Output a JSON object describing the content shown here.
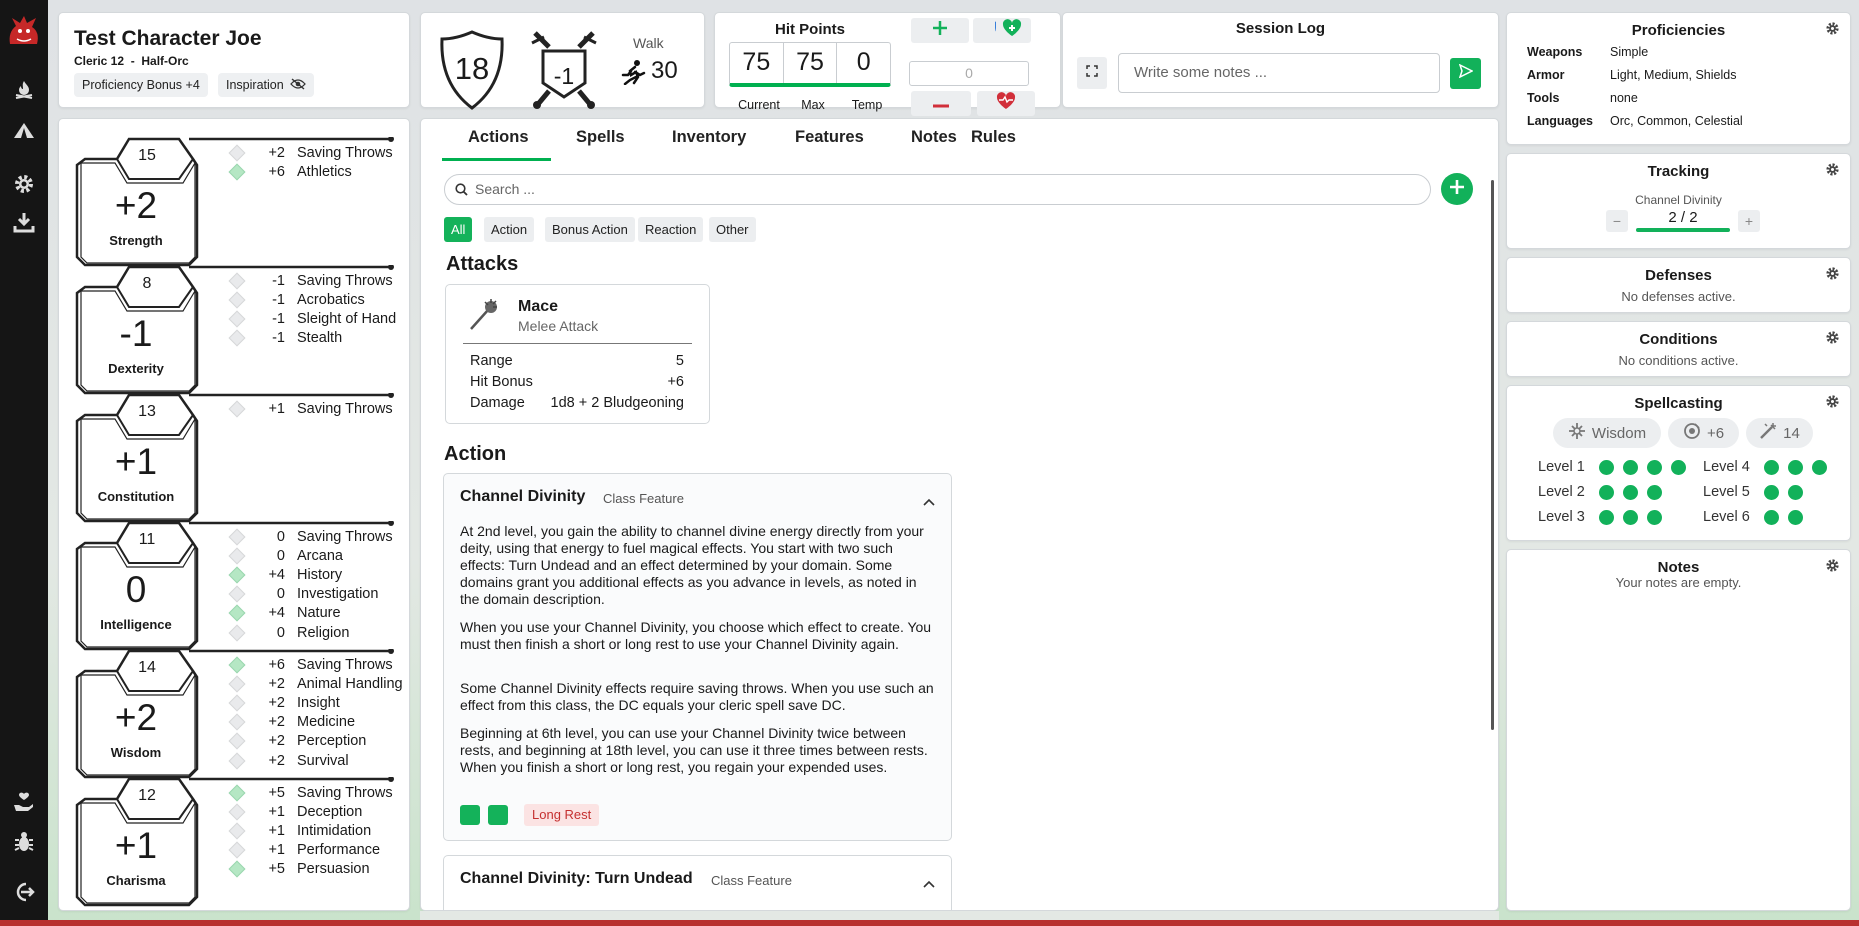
{
  "colors": {
    "accent": "#12b15a",
    "danger": "#c53030",
    "sidebar": "#151515"
  },
  "sidebar": {
    "icons": [
      "dragon-logo-icon",
      "campfire-icon",
      "tent-icon",
      "gear-icon",
      "download-icon",
      "hand-heart-icon",
      "bug-icon",
      "logout-icon"
    ]
  },
  "character": {
    "name": "Test Character Joe",
    "class_line": "Cleric 12  -  Half-Orc",
    "proficiency_bonus": "Proficiency Bonus +4",
    "inspiration": "Inspiration"
  },
  "combat": {
    "ac": "18",
    "initiative": "-1",
    "speed_label": "Walk",
    "speed": "30"
  },
  "hp": {
    "title": "Hit Points",
    "current": "75",
    "max": "75",
    "temp": "0",
    "current_label": "Current",
    "max_label": "Max",
    "temp_label": "Temp",
    "input_placeholder": "0"
  },
  "session_log": {
    "title": "Session Log",
    "placeholder": "Write some notes ..."
  },
  "abilities": [
    {
      "name": "Strength",
      "score": "15",
      "mod": "+2",
      "skills": [
        {
          "mod": "+2",
          "label": "Saving Throws",
          "prof": false
        },
        {
          "mod": "+6",
          "label": "Athletics",
          "prof": true
        }
      ]
    },
    {
      "name": "Dexterity",
      "score": "8",
      "mod": "-1",
      "skills": [
        {
          "mod": "-1",
          "label": "Saving Throws",
          "prof": false
        },
        {
          "mod": "-1",
          "label": "Acrobatics",
          "prof": false
        },
        {
          "mod": "-1",
          "label": "Sleight of Hand",
          "prof": false
        },
        {
          "mod": "-1",
          "label": "Stealth",
          "prof": false
        }
      ]
    },
    {
      "name": "Constitution",
      "score": "13",
      "mod": "+1",
      "skills": [
        {
          "mod": "+1",
          "label": "Saving Throws",
          "prof": false
        }
      ]
    },
    {
      "name": "Intelligence",
      "score": "11",
      "mod": "0",
      "skills": [
        {
          "mod": "0",
          "label": "Saving Throws",
          "prof": false
        },
        {
          "mod": "0",
          "label": "Arcana",
          "prof": false
        },
        {
          "mod": "+4",
          "label": "History",
          "prof": true
        },
        {
          "mod": "0",
          "label": "Investigation",
          "prof": false
        },
        {
          "mod": "+4",
          "label": "Nature",
          "prof": true
        },
        {
          "mod": "0",
          "label": "Religion",
          "prof": false
        }
      ]
    },
    {
      "name": "Wisdom",
      "score": "14",
      "mod": "+2",
      "skills": [
        {
          "mod": "+6",
          "label": "Saving Throws",
          "prof": true
        },
        {
          "mod": "+2",
          "label": "Animal Handling",
          "prof": false
        },
        {
          "mod": "+2",
          "label": "Insight",
          "prof": false
        },
        {
          "mod": "+2",
          "label": "Medicine",
          "prof": false
        },
        {
          "mod": "+2",
          "label": "Perception",
          "prof": false
        },
        {
          "mod": "+2",
          "label": "Survival",
          "prof": false
        }
      ]
    },
    {
      "name": "Charisma",
      "score": "12",
      "mod": "+1",
      "skills": [
        {
          "mod": "+5",
          "label": "Saving Throws",
          "prof": true
        },
        {
          "mod": "+1",
          "label": "Deception",
          "prof": false
        },
        {
          "mod": "+1",
          "label": "Intimidation",
          "prof": false
        },
        {
          "mod": "+1",
          "label": "Performance",
          "prof": false
        },
        {
          "mod": "+5",
          "label": "Persuasion",
          "prof": true
        }
      ]
    }
  ],
  "tabs": [
    "Actions",
    "Spells",
    "Inventory",
    "Features",
    "Notes",
    "Rules"
  ],
  "active_tab": "Actions",
  "search_placeholder": "Search ...",
  "filters": [
    "All",
    "Action",
    "Bonus Action",
    "Reaction",
    "Other"
  ],
  "attacks": {
    "title": "Attacks",
    "name": "Mace",
    "subtitle": "Melee Attack",
    "rows": [
      {
        "label": "Range",
        "value": "5"
      },
      {
        "label": "Hit Bonus",
        "value": "+6"
      },
      {
        "label": "Damage",
        "value": "1d8 + 2 Bludgeoning"
      }
    ]
  },
  "action": {
    "title": "Action",
    "feature1": {
      "name": "Channel Divinity",
      "tag": "Class Feature",
      "paragraphs": [
        "At 2nd level, you gain the ability to channel divine energy directly from your deity, using that energy to fuel magical effects. You start with two such effects: Turn Undead and an effect determined by your domain. Some domains grant you additional effects as you advance in levels, as noted in the domain description.",
        "When you use your Channel Divinity, you choose which effect to create. You must then finish a short or long rest to use your Channel Divinity again.",
        "Some Channel Divinity effects require saving throws. When you use such an effect from this class, the DC equals your cleric spell save DC.",
        "Beginning at 6th level, you can use your Channel Divinity twice between rests, and beginning at 18th level, you can use it three times between rests. When you finish a short or long rest, you regain your expended uses."
      ],
      "recharge": "Long Rest"
    },
    "feature2": {
      "name": "Channel Divinity: Turn Undead",
      "tag": "Class Feature"
    }
  },
  "proficiencies": {
    "title": "Proficiencies",
    "rows": [
      {
        "label": "Weapons",
        "value": "Simple"
      },
      {
        "label": "Armor",
        "value": "Light, Medium, Shields"
      },
      {
        "label": "Tools",
        "value": "none"
      },
      {
        "label": "Languages",
        "value": "Orc, Common, Celestial"
      }
    ]
  },
  "tracking": {
    "title": "Tracking",
    "label": "Channel Divinity",
    "value": "2 / 2",
    "minus": "−",
    "plus": "+"
  },
  "defenses": {
    "title": "Defenses",
    "empty": "No defenses active."
  },
  "conditions": {
    "title": "Conditions",
    "empty": "No conditions active."
  },
  "spellcasting": {
    "title": "Spellcasting",
    "ability": "Wisdom",
    "attack": "+6",
    "dc": "14",
    "slots": [
      {
        "label": "Level 1",
        "count": 4
      },
      {
        "label": "Level 2",
        "count": 3
      },
      {
        "label": "Level 3",
        "count": 3
      },
      {
        "label": "Level 4",
        "count": 3
      },
      {
        "label": "Level 5",
        "count": 2
      },
      {
        "label": "Level 6",
        "count": 2
      }
    ]
  },
  "notes": {
    "title": "Notes",
    "empty": "Your notes are empty."
  }
}
